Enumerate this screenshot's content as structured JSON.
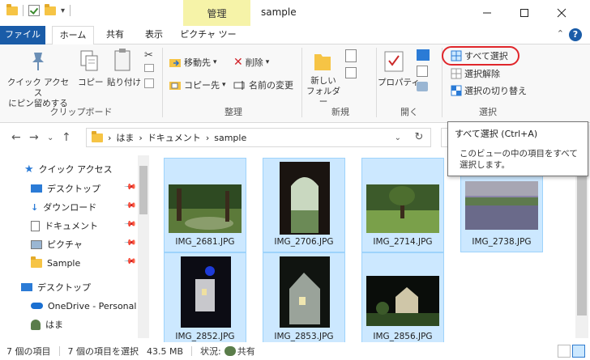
{
  "window": {
    "title": "sample",
    "context_tab_group": "管理",
    "minimize_icon": "minimize-icon",
    "maximize_icon": "maximize-icon",
    "close_icon": "close-icon"
  },
  "quick_access_toolbar": {
    "dropdown_glyph": "▾"
  },
  "tabs": [
    {
      "label": "ファイル",
      "color": "#1a5ca8"
    },
    {
      "label": "ホーム",
      "active": true
    },
    {
      "label": "共有"
    },
    {
      "label": "表示"
    },
    {
      "label": "ピクチャ ツール"
    }
  ],
  "ribbon": {
    "clipboard": {
      "group_label": "クリップボード",
      "pin": "クイック アクセス\nにピン留めする",
      "copy": "コピー",
      "paste": "貼り付け"
    },
    "organize": {
      "group_label": "整理",
      "move_to": "移動先",
      "copy_to": "コピー先",
      "delete": "削除",
      "rename": "名前の変更"
    },
    "new": {
      "group_label": "新規",
      "new_folder": "新しい\nフォルダー"
    },
    "open": {
      "group_label": "開く",
      "properties": "プロパティ"
    },
    "select": {
      "group_label": "選択",
      "select_all": "すべて選択",
      "select_none": "選択解除",
      "invert": "選択の切り替え",
      "highlight_color": "#e0262b"
    }
  },
  "address_bar": {
    "path": [
      "はま",
      "ドキュメント",
      "sample"
    ],
    "separator": "›"
  },
  "tooltip": {
    "title": "すべて選択 (Ctrl+A)",
    "body": "このビューの中の項目をすべて選択します。"
  },
  "nav_pane": {
    "quick_access": "クイック アクセス",
    "items": [
      {
        "label": "デスクトップ",
        "icon": "desktop-icon",
        "pinned": true
      },
      {
        "label": "ダウンロード",
        "icon": "download-icon",
        "pinned": true
      },
      {
        "label": "ドキュメント",
        "icon": "document-icon",
        "pinned": true
      },
      {
        "label": "ピクチャ",
        "icon": "pictures-icon",
        "pinned": true
      },
      {
        "label": "Sample",
        "icon": "folder-icon",
        "pinned": true
      }
    ],
    "root_items": [
      {
        "label": "デスクトップ",
        "icon": "desktop-icon"
      },
      {
        "label": "OneDrive - Personal",
        "icon": "onedrive-icon"
      },
      {
        "label": "はま",
        "icon": "user-icon"
      }
    ]
  },
  "files": [
    {
      "name": "IMG_2681.JPG",
      "scene": "forest-lawn"
    },
    {
      "name": "IMG_2706.JPG",
      "scene": "window-arch"
    },
    {
      "name": "IMG_2714.JPG",
      "scene": "tree-meadow"
    },
    {
      "name": "IMG_2738.JPG",
      "scene": "lavender"
    },
    {
      "name": "IMG_2852.JPG",
      "scene": "night-house"
    },
    {
      "name": "IMG_2853.JPG",
      "scene": "night-building"
    },
    {
      "name": "IMG_2856.JPG",
      "scene": "night-garden"
    }
  ],
  "status_bar": {
    "item_count": "7 個の項目",
    "selected": "7 個の項目を選択",
    "size": "43.5 MB",
    "state": "状況:",
    "state_value": "共有"
  }
}
